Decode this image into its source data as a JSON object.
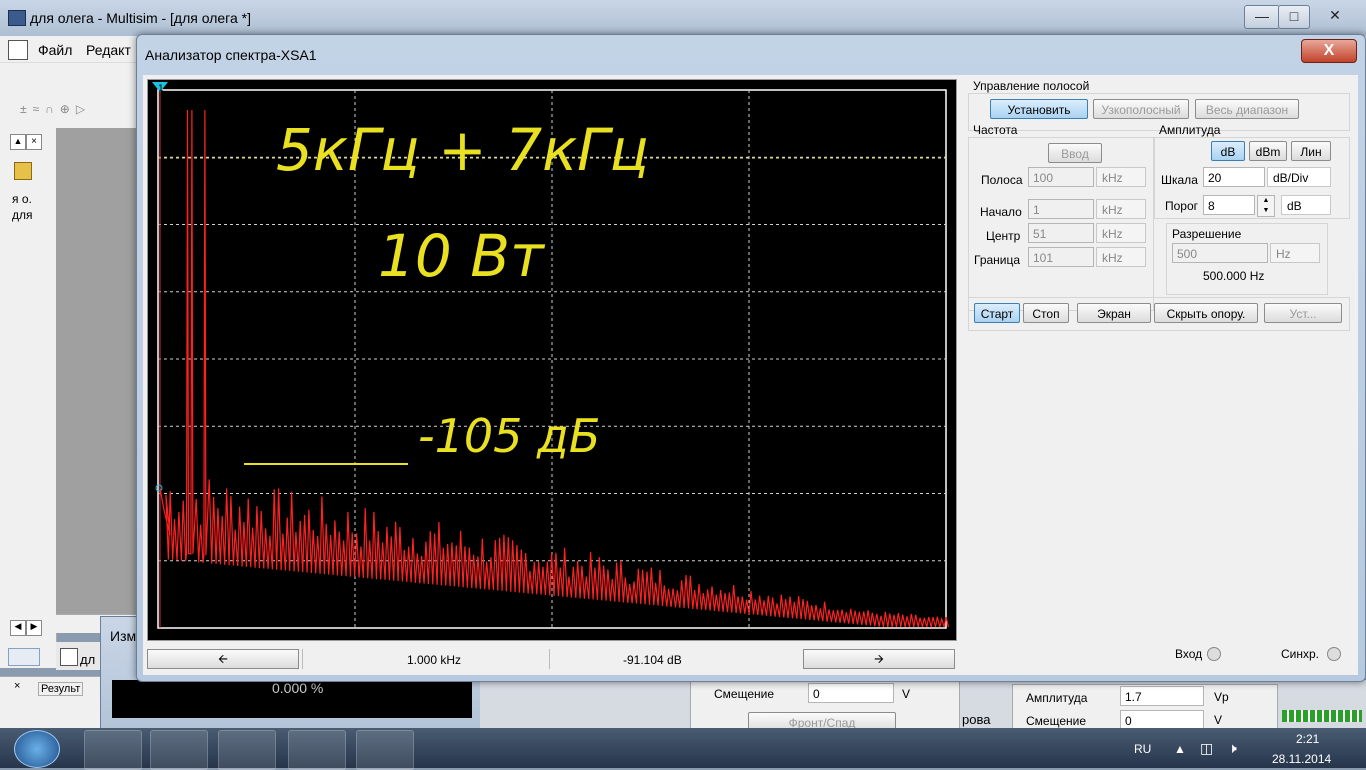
{
  "main_window": {
    "title": "для олега - Multisim - [для олега *]",
    "menu": {
      "file": "Файл",
      "edit": "Редакт"
    },
    "left_panel": {
      "item1": "я о.",
      "item2": "для"
    },
    "bottom_tab": "дл",
    "bottom_window_title": "Изм",
    "results_tab": "Результ",
    "results_value": "0.000 %"
  },
  "bg_generator": {
    "offset_label": "Смещение",
    "offset_value": "0",
    "offset_unit": "V",
    "front_button": "Фронт/Спад",
    "amp_label": "Амплитуда",
    "amp_value": "1.7",
    "amp_unit": "Vp",
    "offset2_label": "Смещение",
    "offset2_value": "0",
    "offset2_unit": "V",
    "cut_text": "рова"
  },
  "analyzer": {
    "title": "Анализатор спектра-XSA1",
    "close_glyph": "X",
    "band_control": {
      "label": "Управление полосой",
      "set": "Установить",
      "narrow": "Узкополосный",
      "full": "Весь диапазон"
    },
    "frequency": {
      "label": "Частота",
      "enter": "Ввод",
      "span_label": "Полоса",
      "span_value": "100",
      "span_unit": "kHz",
      "start_label": "Начало",
      "start_value": "1",
      "start_unit": "kHz",
      "center_label": "Центр",
      "center_value": "51",
      "center_unit": "kHz",
      "end_label": "Граница",
      "end_value": "101",
      "end_unit": "kHz"
    },
    "amplitude": {
      "label": "Амплитуда",
      "db": "dB",
      "dbm": "dBm",
      "lin": "Лин",
      "scale_label": "Шкала",
      "scale_value": "20",
      "scale_unit": "dB/Div",
      "threshold_label": "Порог",
      "threshold_value": "8",
      "threshold_unit": "dB"
    },
    "resolution": {
      "label": "Разрешение",
      "value": "500",
      "unit": "Hz",
      "readout": "500.000  Hz"
    },
    "actions": {
      "start": "Старт",
      "stop": "Стоп",
      "screen": "Экран",
      "hide_ref": "Скрыть опору.",
      "settings": "Уст..."
    },
    "inputs": {
      "in": "Вход",
      "sync": "Синхр."
    },
    "cursor": {
      "freq": "1.000 kHz",
      "level": "-91.104  dB"
    },
    "annotations": [
      "5кГц + 7кГц",
      "10 Вт",
      "-105 дБ"
    ],
    "marker_label": "1"
  },
  "chart_data": {
    "type": "line",
    "title": "",
    "xlabel": "",
    "ylabel": "",
    "grid": true,
    "xlim": [
      1,
      101
    ],
    "x_unit": "kHz",
    "peaks_khz": [
      5,
      7
    ],
    "series": [
      {
        "name": "",
        "color": "#ff2020"
      }
    ]
  },
  "taskbar": {
    "lang": "RU",
    "time": "2:21",
    "date": "28.11.2014",
    "apps": [
      "calculator-icon",
      "chrome-icon",
      "explorer-icon",
      "paint-icon",
      "multisim-icon"
    ]
  },
  "colors": {
    "trace": "#ff2020",
    "grid": "#d0d0d0",
    "annotation": "#e8e020"
  }
}
